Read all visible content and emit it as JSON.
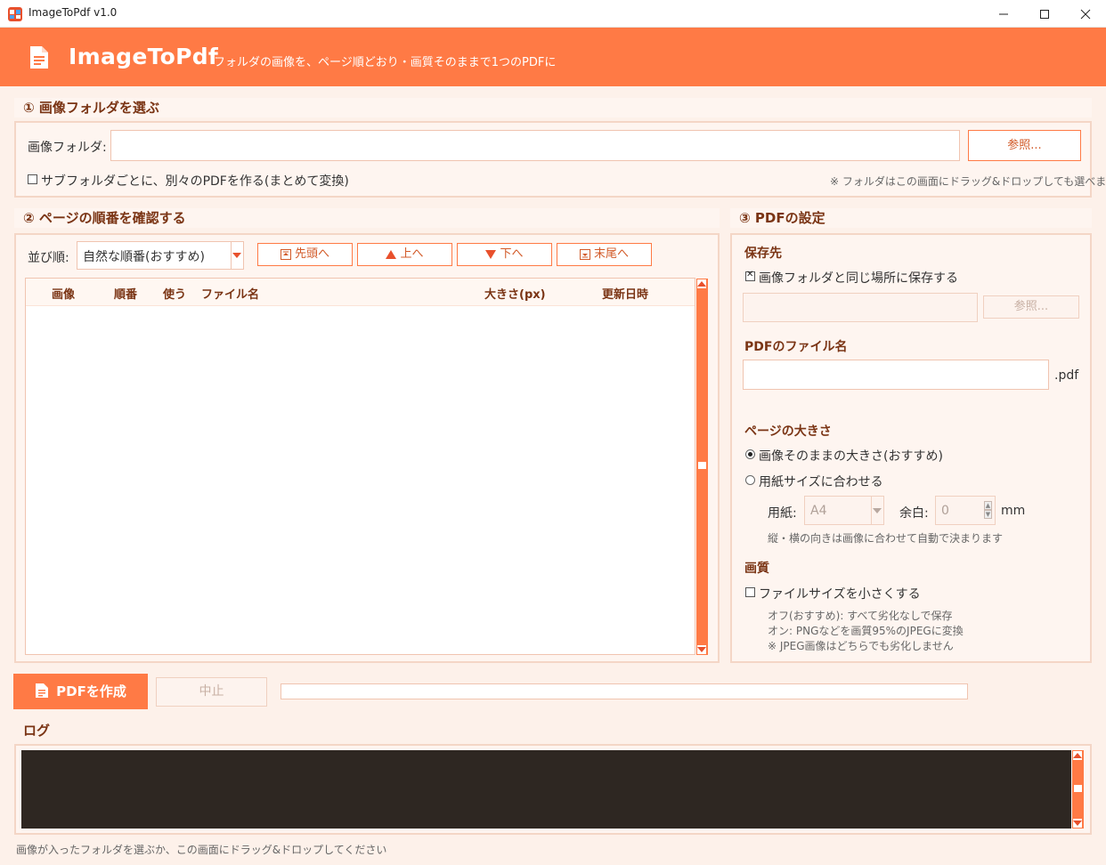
{
  "window": {
    "title": "ImageToPdf v1.0"
  },
  "header": {
    "app_name": "ImageToPdf",
    "tagline": "フォルダの画像を、ページ順どおり・画質そのままで1つのPDFに"
  },
  "section1": {
    "title": "① 画像フォルダを選ぶ",
    "folder_label": "画像フォルダ:",
    "folder_value": "",
    "browse_label": "参照...",
    "subfolder_checkbox_label": "サブフォルダごとに、別々のPDFを作る(まとめて変換)",
    "subfolder_checked": false,
    "drop_hint": "※ フォルダはこの画面にドラッグ&ドロップしても選べます"
  },
  "section2": {
    "title": "② ページの順番を確認する",
    "sort_label": "並び順:",
    "sort_value": "自然な順番(おすすめ)",
    "buttons": {
      "top": "先頭へ",
      "up": "上へ",
      "down": "下へ",
      "bottom": "末尾へ"
    },
    "columns": [
      "画像",
      "順番",
      "使う",
      "ファイル名",
      "大きさ(px)",
      "更新日時"
    ]
  },
  "section3": {
    "title": "③ PDFの設定",
    "save_dest_heading": "保存先",
    "same_folder_label": "画像フォルダと同じ場所に保存する",
    "same_folder_checked": true,
    "save_path_value": "",
    "save_browse_label": "参照...",
    "filename_heading": "PDFのファイル名",
    "filename_value": "",
    "filename_ext": ".pdf",
    "page_size_heading": "ページの大きさ",
    "page_size_original_label": "画像そのままの大きさ(おすすめ)",
    "page_size_fit_label": "用紙サイズに合わせる",
    "page_size_selected": "original",
    "paper_label": "用紙:",
    "paper_value": "A4",
    "margin_label": "余白:",
    "margin_value": "0",
    "margin_unit": "mm",
    "orientation_note": "縦・横の向きは画像に合わせて自動で決まります",
    "quality_heading": "画質",
    "reduce_size_label": "ファイルサイズを小さくする",
    "reduce_size_checked": false,
    "quality_note_1": "オフ(おすすめ): すべて劣化なしで保存",
    "quality_note_2": "オン: PNGなどを画質95%のJPEGに変換",
    "quality_note_3": "※ JPEG画像はどちらでも劣化しません"
  },
  "actions": {
    "create_label": "PDFを作成",
    "cancel_label": "中止",
    "progress": 0
  },
  "log": {
    "title": "ログ"
  },
  "status_bar": {
    "text": "画像が入ったフォルダを選ぶか、この画面にドラッグ&ドロップしてください"
  },
  "colors": {
    "accent": "#ff7a45",
    "background": "#fdf1ea",
    "heading": "#7a3414",
    "log_bg": "#2e2722"
  }
}
